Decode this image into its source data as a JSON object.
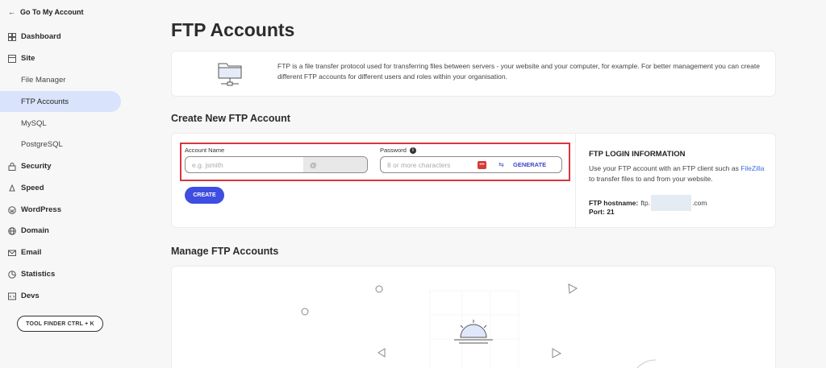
{
  "sidebar": {
    "back_label": "Go To My Account",
    "items": [
      {
        "label": "Dashboard",
        "icon": "grid-icon"
      },
      {
        "label": "Site",
        "icon": "site-icon"
      },
      {
        "label": "Security",
        "icon": "lock-icon"
      },
      {
        "label": "Speed",
        "icon": "rocket-icon"
      },
      {
        "label": "WordPress",
        "icon": "wordpress-icon"
      },
      {
        "label": "Domain",
        "icon": "globe-icon"
      },
      {
        "label": "Email",
        "icon": "mail-icon"
      },
      {
        "label": "Statistics",
        "icon": "stats-icon"
      },
      {
        "label": "Devs",
        "icon": "code-icon"
      }
    ],
    "site_subitems": [
      "File Manager",
      "FTP Accounts",
      "MySQL",
      "PostgreSQL"
    ],
    "active_subitem": "FTP Accounts",
    "tool_finder_label": "TOOL FINDER CTRL + K"
  },
  "page": {
    "title": "FTP Accounts",
    "info_text": "FTP is a file transfer protocol used for transferring files between servers - your website and your computer, for example. For better management you can create different FTP accounts for different users and roles within your organisation."
  },
  "create": {
    "section_title": "Create New FTP Account",
    "account_label": "Account Name",
    "account_placeholder": "e.g. jsmith",
    "account_suffix": "@",
    "password_label": "Password",
    "password_placeholder": "8 or more characters",
    "generate_label": "GENERATE",
    "create_label": "CREATE"
  },
  "login_info": {
    "title": "FTP LOGIN INFORMATION",
    "text_before": "Use your FTP account with an FTP client such as ",
    "link": "FileZilla",
    "text_after": " to transfer files to and from your website.",
    "host_label": "FTP hostname:",
    "host_prefix": "ftp.",
    "host_suffix": ".com",
    "port_label": "Port: 21"
  },
  "manage": {
    "section_title": "Manage FTP Accounts"
  },
  "colors": {
    "accent": "#3e4ee0",
    "active_nav": "#d9e3fb",
    "highlight_red": "#d9363e"
  }
}
